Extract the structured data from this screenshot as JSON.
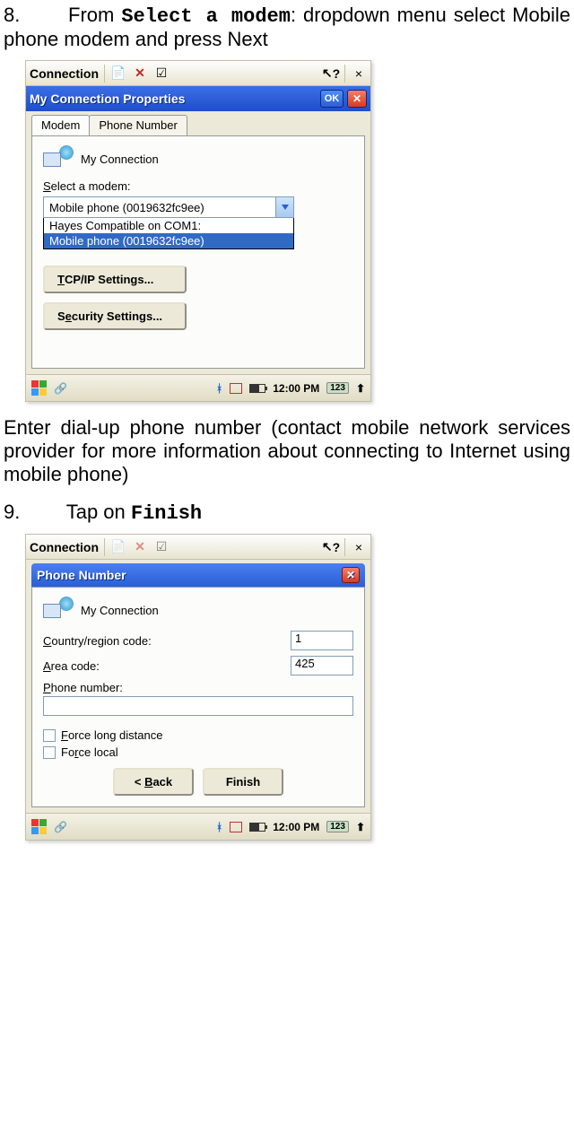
{
  "step8": {
    "num": "8.",
    "prefix": "From ",
    "term": "Select a modem",
    "suffix": ": dropdown menu select Mobile phone modem and press Next"
  },
  "screenshot1": {
    "toolbar": {
      "label": "Connection",
      "help": "?",
      "close": "×"
    },
    "title": "My Connection Properties",
    "ok": "OK",
    "tabs": {
      "modem": "Modem",
      "phone": "Phone Number"
    },
    "conn_name": "My Connection",
    "select_label_u": "S",
    "select_label_rest": "elect a modem:",
    "combo_value": "Mobile phone (0019632fc9ee)",
    "combo_items": {
      "a": "Hayes Compatible on COM1:",
      "b": "Mobile phone (0019632fc9ee)"
    },
    "btn_tcp_u": "T",
    "btn_tcp_rest": "CP/IP Settings...",
    "btn_sec_pre": "S",
    "btn_sec_u": "e",
    "btn_sec_rest": "curity Settings...",
    "taskbar": {
      "time": "12:00 PM",
      "kbd": "123"
    }
  },
  "para_dial": "Enter dial-up phone number (contact mobile network services provider for more information about connecting to Internet using mobile phone)",
  "step9": {
    "num": "9.",
    "prefix": "Tap on ",
    "term": "Finish"
  },
  "screenshot2": {
    "toolbar": {
      "label": "Connection",
      "help": "?",
      "close": "×"
    },
    "title": "Phone Number",
    "conn_name": "My Connection",
    "country_u": "C",
    "country_rest": "ountry/region code:",
    "country_val": "1",
    "area_u": "A",
    "area_rest": "rea code:",
    "area_val": "425",
    "phone_u": "P",
    "phone_rest": "hone number:",
    "chk1_u": "F",
    "chk1_rest": "orce long distance",
    "chk2_pre": "Fo",
    "chk2_u": "r",
    "chk2_rest": "ce local",
    "btn_back_lt": "<  ",
    "btn_back_u": "B",
    "btn_back_rest": "ack",
    "btn_finish": "Finish",
    "taskbar": {
      "time": "12:00 PM",
      "kbd": "123"
    }
  }
}
